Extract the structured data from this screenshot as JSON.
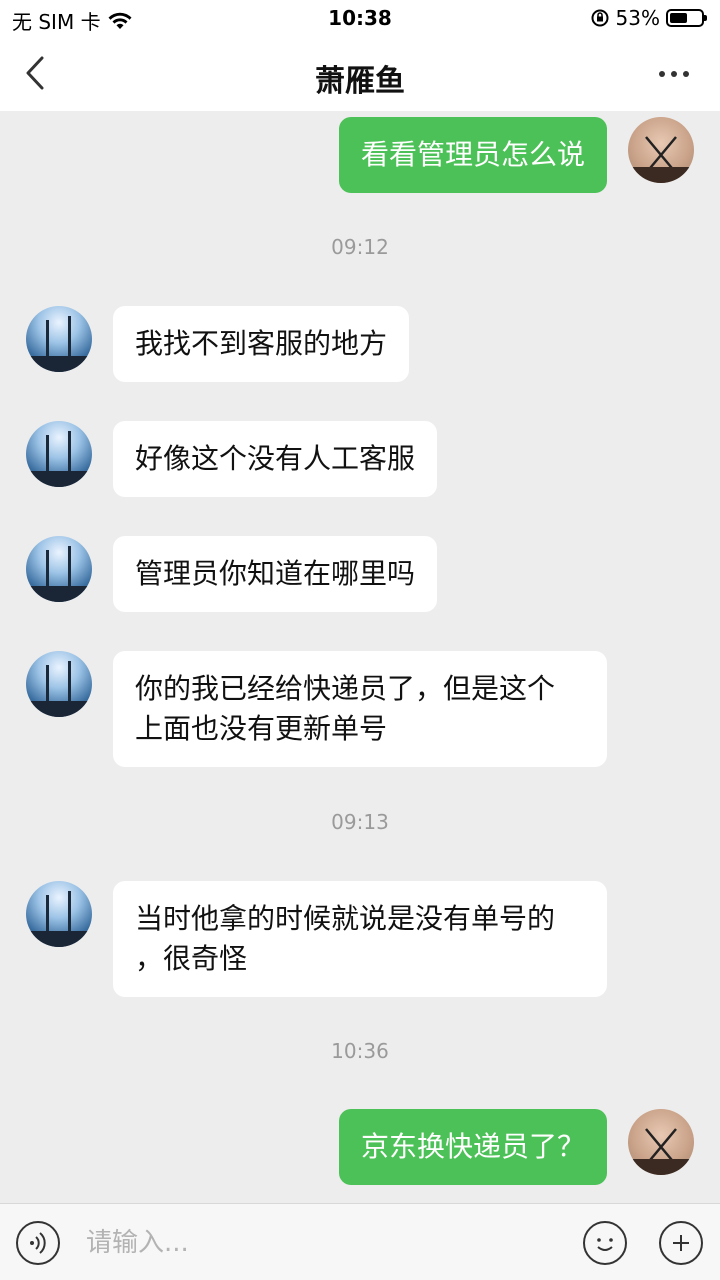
{
  "status_bar": {
    "carrier": "无 SIM 卡",
    "time": "10:38",
    "battery": "53%",
    "battery_level": 0.53
  },
  "header": {
    "title": "萧雁鱼",
    "back_icon": "chevron-left-icon",
    "more_icon": "more-dots-icon"
  },
  "messages": {
    "m1": "看看管理员怎么说",
    "ts1": "09:12",
    "m2": "我找不到客服的地方",
    "m3": "好像这个没有人工客服",
    "m4": "管理员你知道在哪里吗",
    "m5": "你的我已经给快递员了，但是这个\n上面也没有更新单号",
    "ts2": "09:13",
    "m6": "当时他拿的时候就说是没有单号的\n，很奇怪",
    "ts3": "10:36",
    "m7": "京东换快递员了？"
  },
  "input_bar": {
    "placeholder": "请输入...",
    "voice_icon": "voice-icon",
    "emoji_icon": "emoji-icon",
    "plus_icon": "plus-icon"
  },
  "colors": {
    "outgoing_bubble": "#4cc157",
    "incoming_bubble": "#ffffff",
    "background": "#ededed"
  }
}
